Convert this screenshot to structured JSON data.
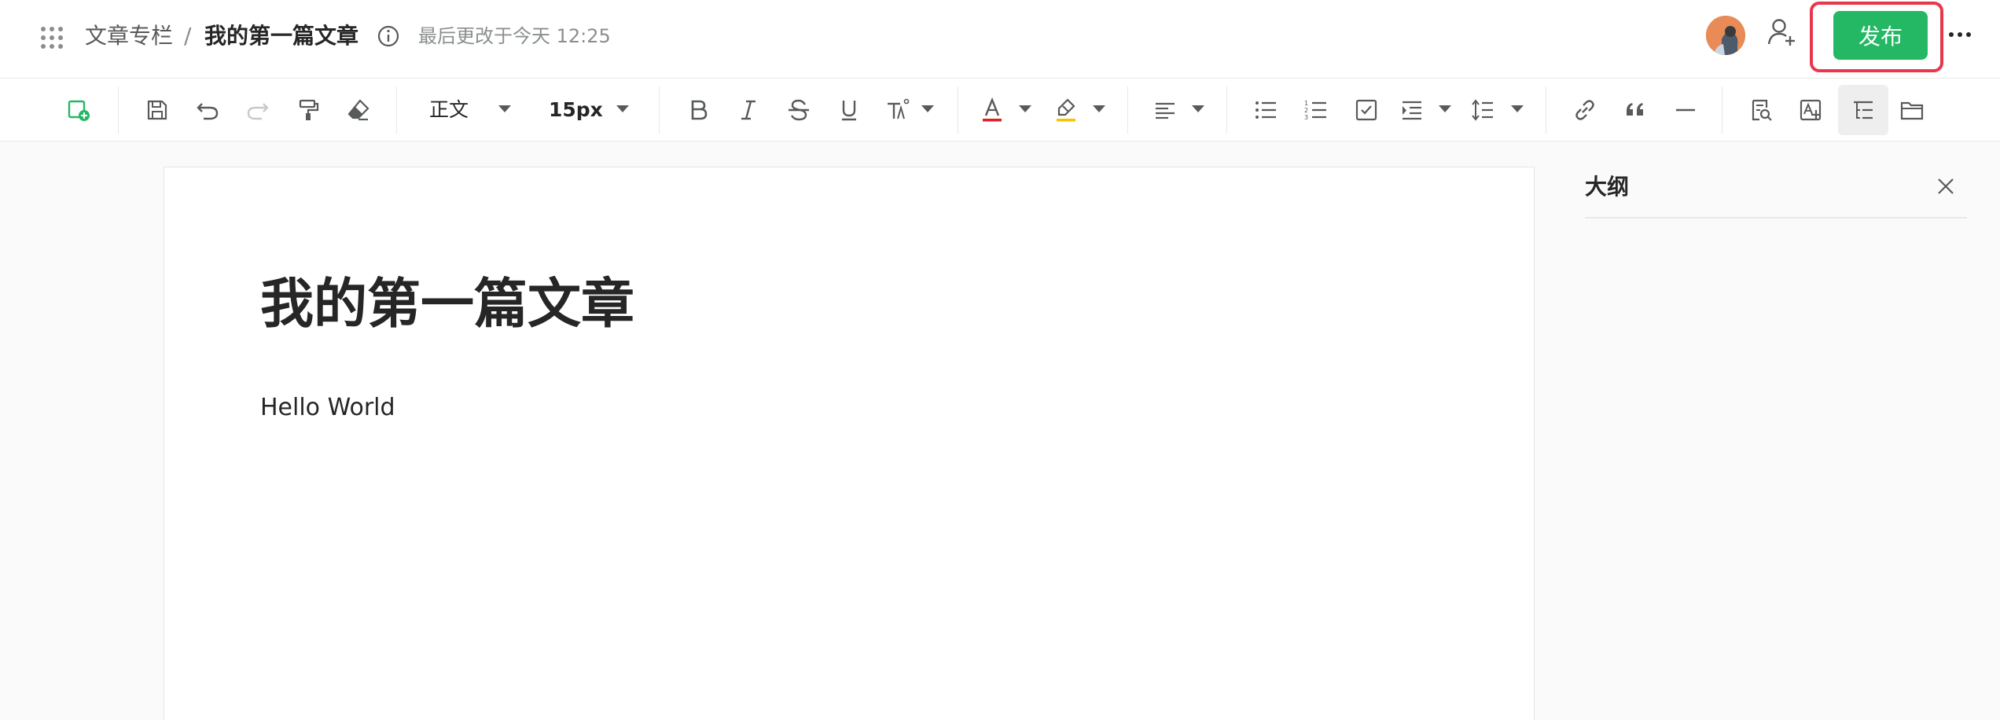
{
  "header": {
    "breadcrumb_column": "文章专栏",
    "breadcrumb_separator": "/",
    "doc_title": "我的第一篇文章",
    "last_modified": "最后更改于今天 12:25",
    "publish_label": "发布"
  },
  "toolbar": {
    "paragraph_style": "正文",
    "font_size": "15px"
  },
  "document": {
    "title": "我的第一篇文章",
    "body": "Hello World"
  },
  "outline": {
    "title": "大纲"
  },
  "colors": {
    "accent_green": "#25b864",
    "highlight_red": "#e8374b",
    "font_color_red": "#e02020",
    "highlight_yellow": "#f5c400"
  }
}
